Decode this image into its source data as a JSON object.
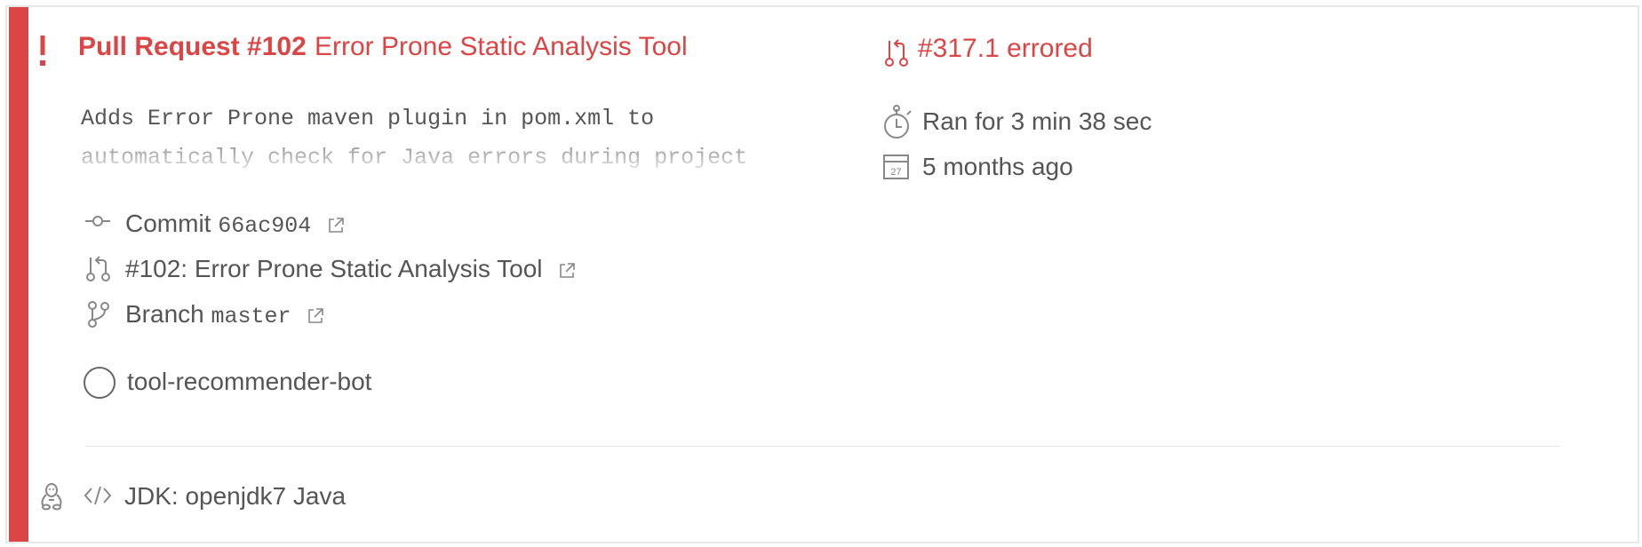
{
  "build": {
    "status_color": "#db4545",
    "event_label": "Pull Request #102",
    "pr_title": "Error Prone Static Analysis Tool",
    "commit_message": "Adds Error Prone maven plugin in pom.xml to automatically check for Java errors during project",
    "commit_label": "Commit",
    "commit_sha": "66ac904",
    "pr_link_text": "#102: Error Prone Static Analysis Tool",
    "branch_label": "Branch",
    "branch_name": "master",
    "author": "tool-recommender-bot",
    "build_number": "#317.1 errored",
    "duration": "Ran for 3 min 38 sec",
    "finished": "5 months ago",
    "calendar_day": "27"
  },
  "jobs": {
    "os_icon": "linux-tux-icon",
    "language_icon": "code-brackets-icon",
    "env_text": "JDK: openjdk7 Java"
  }
}
